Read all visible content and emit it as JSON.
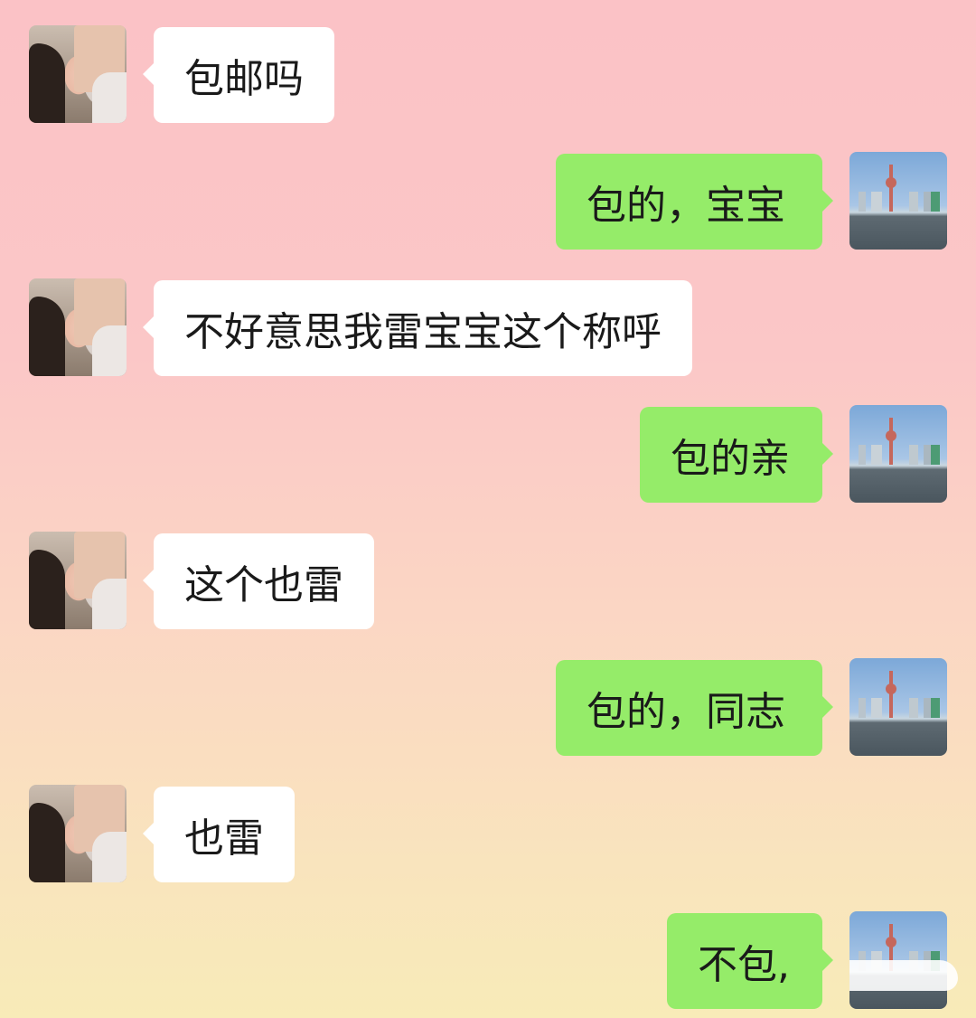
{
  "messages": [
    {
      "side": "left",
      "text": "包邮吗"
    },
    {
      "side": "right",
      "text": "包的，宝宝"
    },
    {
      "side": "left",
      "text": "不好意思我雷宝宝这个称呼"
    },
    {
      "side": "right",
      "text": "包的亲"
    },
    {
      "side": "left",
      "text": "这个也雷"
    },
    {
      "side": "right",
      "text": "包的，同志"
    },
    {
      "side": "left",
      "text": "也雷"
    },
    {
      "side": "right",
      "text": "不包,"
    }
  ],
  "colors": {
    "bubble_self": "#95ec69",
    "bubble_other": "#ffffff"
  },
  "icons": {
    "other_avatar": "girl-avatar-icon",
    "self_avatar": "city-skyline-avatar-icon"
  }
}
